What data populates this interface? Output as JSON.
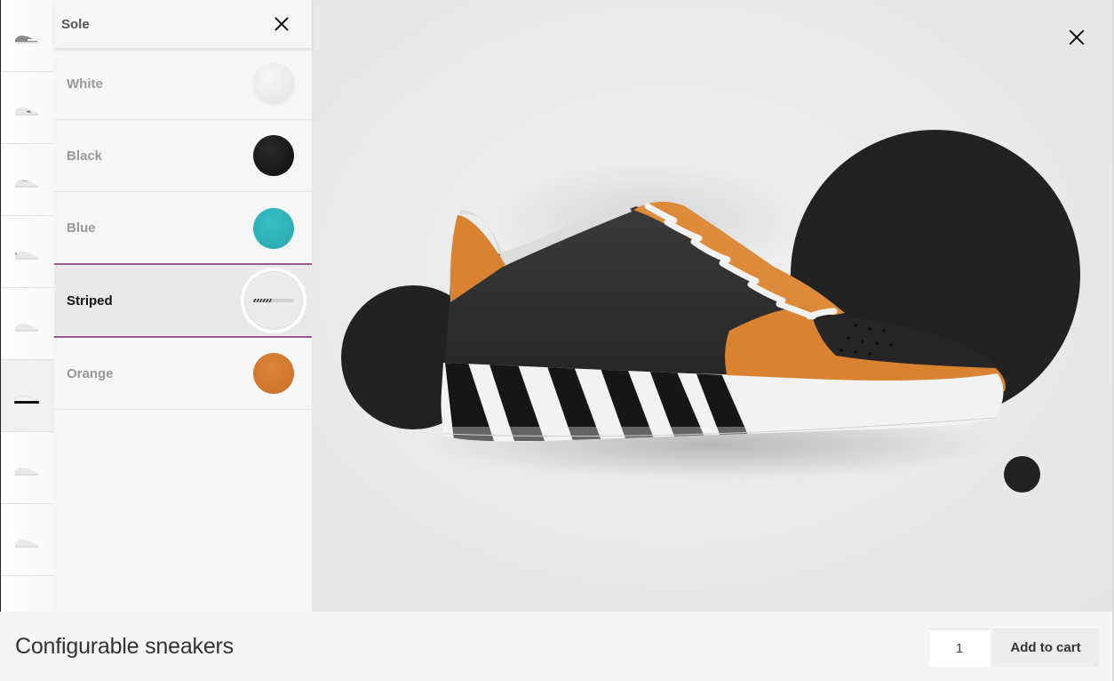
{
  "colors": {
    "accent": "#9c5a8c",
    "dark_circle": "#222222",
    "stage_bg": "#e9e9e9"
  },
  "thumbnails": [
    {
      "label": "Shoe view 1",
      "variant": "dark-upper"
    },
    {
      "label": "Shoe view 2",
      "variant": "dark-accent"
    },
    {
      "label": "Shoe view 3",
      "variant": "white"
    },
    {
      "label": "Shoe view 4",
      "variant": "white"
    },
    {
      "label": "Shoe view 5",
      "variant": "white"
    },
    {
      "label": "Shoe view 6",
      "variant": "black-sole",
      "active": true
    },
    {
      "label": "Shoe view 7",
      "variant": "white"
    },
    {
      "label": "Shoe view 8",
      "variant": "white"
    }
  ],
  "panel": {
    "title": "Sole",
    "close_icon": "close-icon",
    "options": [
      {
        "label": "White",
        "swatch": "#ebebeb",
        "selected": false
      },
      {
        "label": "Black",
        "swatch": "#1a1a1a",
        "selected": false
      },
      {
        "label": "Blue",
        "swatch": "#2fb4bd",
        "selected": false
      },
      {
        "label": "Striped",
        "swatch": "striped-sole-thumbnail",
        "selected": true
      },
      {
        "label": "Orange",
        "swatch": "#d4782f",
        "selected": false
      }
    ]
  },
  "stage": {
    "close_icon": "close-icon",
    "image": "orange-black sneaker with striped sole"
  },
  "footer": {
    "product_title": "Configurable sneakers",
    "quantity": "1",
    "add_to_cart_label": "Add to cart"
  }
}
